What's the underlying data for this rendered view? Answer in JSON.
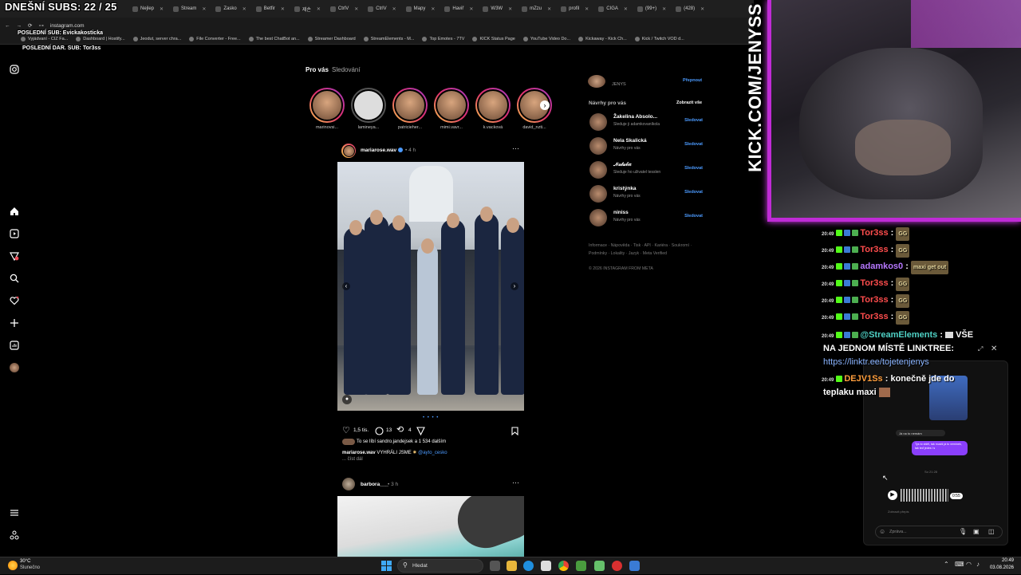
{
  "overlay": {
    "subs_title": "DNEŠNÍ SUBS: 22 / 25",
    "last_sub": "POSLEDNÍ SUB: Evickakosticka",
    "last_dar": "POSLEDNÍ DAR. SUB: Tor3ss",
    "kick_url": "KICK.COM/JENYSS"
  },
  "browser": {
    "tabs": [
      "Nejlep",
      "Stream",
      "Zasko",
      "Betfir",
      "제손",
      "CtrlV",
      "CtrlV",
      "Mapy",
      "Haviř",
      "W3W",
      "mZzu",
      "profil",
      "CIGA",
      "(99+)",
      "(428)"
    ],
    "url": "instagram.com",
    "bookmarks": [
      "Vyjádvaní - CIZ Fa...",
      "Dashboard | Hostify...",
      "Jeodut, server chra...",
      "File Converter - Free...",
      "The best ChatBot an...",
      "Streamer Dashboard",
      "StreamElements - M...",
      "Top Emotes - 7TV",
      "KICK Status Page",
      "YouTube Video Do...",
      "Kickaway - Kick Ch...",
      "Kick / Twitch VOD d..."
    ]
  },
  "feed": {
    "tab_for_you": "Pro vás",
    "tab_following": "Sledování",
    "stories": [
      "marinovsi...",
      "lamineya...",
      "patricieher...",
      "mimi.vavr...",
      "k.vacková",
      "david_nzti..."
    ],
    "post1": {
      "user": "mariarose.wav",
      "time": "• 4 h",
      "likes": "1,5 tis.",
      "comments": "13",
      "reposts": "4",
      "liked_by": "To se líbí sandro.jandejsek a 1 534 dalším",
      "caption_user": "mariarose.wav",
      "caption": "VYHRÁLI JSME",
      "caption_tag": "@ayto_cesko",
      "more": "... číst dál"
    },
    "post2": {
      "user": "barbora___",
      "time": "• 3 h"
    }
  },
  "right": {
    "account_name": "JENYS",
    "switch": "Přepnout",
    "suggestions_title": "Návrhy pro vás",
    "show_all": "Zobrazit vše",
    "suggestions": [
      {
        "name": "Žakelina Absolo...",
        "sub": "Sleduje ji adamkovaníkola",
        "action": "Sledovat"
      },
      {
        "name": "Nela Skalická",
        "sub": "Návrhy pro vás",
        "action": "Sledovat"
      },
      {
        "name": "𝒩𝒶𝓉𝒶𝓁𝒾𝑒",
        "sub": "Sleduje ho uživatel tesslen",
        "action": "Sledovat"
      },
      {
        "name": "kristýnka",
        "sub": "Návrhy pro vás",
        "action": "Sledovat"
      },
      {
        "name": "niniss",
        "sub": "Návrhy pro vás",
        "action": "Sledovat"
      }
    ],
    "footer1": "Informace · Nápověda · Tisk · API · Kariéra · Soukromí ·",
    "footer2": "Podmínky · Lokality · Jazyk · Meta Verified",
    "copyright": "© 2026 INSTAGRAM FROM META"
  },
  "chat": [
    {
      "time": "20:49",
      "user": "Tor3ss",
      "msg": "GG",
      "color": "#ff4d4d"
    },
    {
      "time": "20:49",
      "user": "Tor3ss",
      "msg": "GG",
      "color": "#ff4d4d"
    },
    {
      "time": "20:49",
      "user": "adamkos0",
      "msg": "maxi get out",
      "color": "#b678ff"
    },
    {
      "time": "20:49",
      "user": "Tor3ss",
      "msg": "GG",
      "color": "#ff4d4d"
    },
    {
      "time": "20:49",
      "user": "Tor3ss",
      "msg": "GG",
      "color": "#ff4d4d"
    },
    {
      "time": "20:49",
      "user": "Tor3ss",
      "msg": "GG",
      "color": "#ff4d4d"
    }
  ],
  "chat_special": {
    "time": "20:49",
    "user": "@StreamElements",
    "line1": "VŠE",
    "line2": "NA JEDNOM MÍSTĚ LINKTREE:",
    "link": "https://linktr.ee/tojetenjenys",
    "user_color": "#4fd1c5"
  },
  "chat_last": {
    "time": "20:49",
    "user": "DEJV1Ss",
    "msg": "konečně jde do",
    "msg2": "teplaku maxi",
    "color": "#ff9e3d"
  },
  "dm": {
    "msg1": "Já na to nemám",
    "msg2": "Tys to viděl, tak musíš já to vemínek, tak teď jedes i s",
    "time_label": "So 21:28",
    "duration": "0:55",
    "transcript": "Zobrazit přepis",
    "input_placeholder": "Zpráva..."
  },
  "taskbar": {
    "weather_temp": "30°C",
    "weather_desc": "Slunečno",
    "search": "Hledat",
    "time": "20:49",
    "date": "03.08.2026"
  },
  "colors": {
    "ig_blue": "#4c9bff",
    "neon": "#c02bd6",
    "kick_green": "#53fc18"
  }
}
